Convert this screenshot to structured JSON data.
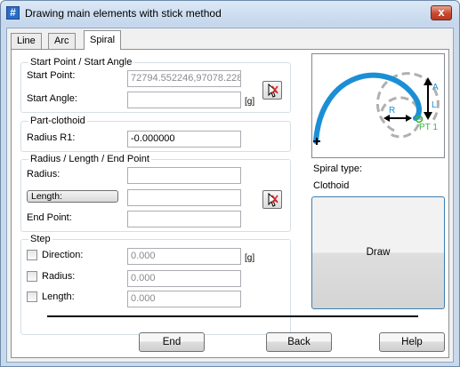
{
  "window": {
    "title": "Drawing main elements with stick method",
    "close_glyph": "x",
    "icon_glyph": "#"
  },
  "tabs": [
    {
      "label": "Line",
      "active": false
    },
    {
      "label": "Arc",
      "active": false
    },
    {
      "label": "Spiral",
      "active": true
    }
  ],
  "start_group": {
    "legend": "Start Point / Start Angle",
    "start_point_label": "Start Point:",
    "start_point_value": "72794.552246,97078.228",
    "start_angle_label": "Start Angle:",
    "start_angle_value": "",
    "angle_unit": "[g]"
  },
  "part_clothoid": {
    "legend": "Part-clothoid",
    "radius_label": "Radius R1:",
    "radius_value": "-0.000000"
  },
  "rle_group": {
    "legend": "Radius / Length / End Point",
    "radius_label": "Radius:",
    "radius_value": "",
    "length_button": "Length:",
    "length_value": "",
    "end_point_label": "End Point:",
    "end_point_value": ""
  },
  "step_group": {
    "legend": "Step",
    "direction_label": "Direction:",
    "direction_value": "0.000",
    "direction_unit": "[g]",
    "direction_checked": false,
    "radius_label": "Radius:",
    "radius_value": "0.000",
    "radius_checked": false,
    "length_label": "Length:",
    "length_value": "0.000",
    "length_checked": false
  },
  "preview": {
    "icon": "clothoid-diagram",
    "label_a": "A",
    "label_l": "L",
    "label_r": "R",
    "label_pt1": "PT 1",
    "curve_color": "#1b8fd6",
    "arrow_color": "#000000",
    "dashed_color": "#b0b0b0",
    "pt_color": "#3bb54a"
  },
  "spiral_type_label": "Spiral type:",
  "spiral_type_value": "Clothoid",
  "draw_button": "Draw",
  "footer": {
    "end": "End",
    "back": "Back",
    "help": "Help"
  }
}
